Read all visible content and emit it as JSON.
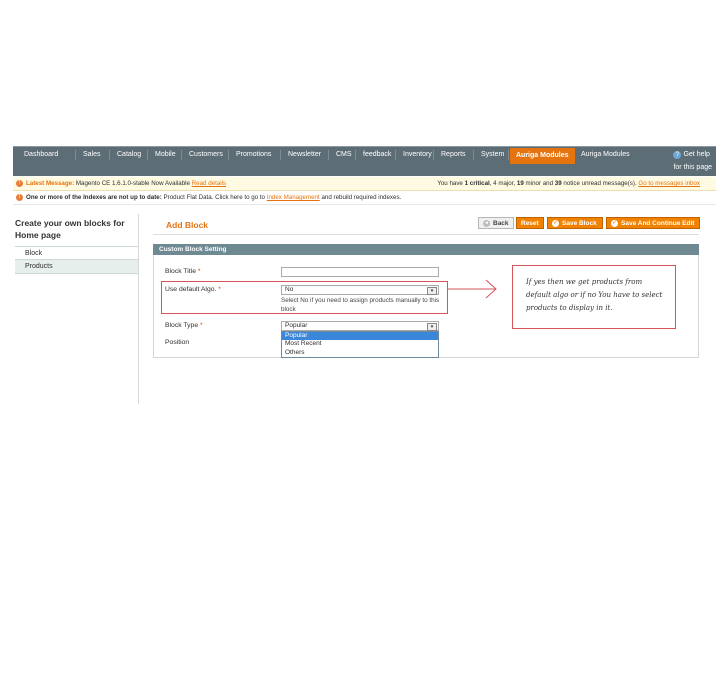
{
  "nav": {
    "items": [
      "Dashboard",
      "Sales",
      "Catalog",
      "Mobile",
      "Customers",
      "Promotions",
      "Newsletter",
      "CMS",
      "feedback",
      "Inventory",
      "Reports",
      "System",
      "Auriga Modules",
      "Auriga Modules"
    ],
    "active_index": 12,
    "help_line1": "Get help",
    "help_line2": "for this page",
    "accent": "#e57310",
    "bar_color": "#5d6d76"
  },
  "messages": {
    "latest_label": "Latest Message:",
    "latest_text": "Magento CE 1.6.1.0-stable Now Available",
    "latest_link": "Read details",
    "notice_prefix": "You have",
    "notice_critical_count": "1",
    "notice_critical": "critical",
    "notice_major": ", 4 major,",
    "notice_minor_count": "19",
    "notice_minor": "minor and",
    "notice_count": "39",
    "notice_rest": "notice unread message(s).",
    "notice_link": "Go to messages inbox",
    "index_label": "One or more of the Indexes are not up to date:",
    "index_text": "Product Flat Data. Click here to go to",
    "index_link": "Index Management",
    "index_rest": "and rebuild required indexes."
  },
  "sidebar": {
    "title": "Create your own blocks for Home page",
    "tabs": [
      "Block",
      "Products"
    ]
  },
  "page": {
    "title": "Add Block",
    "buttons": {
      "back": "Back",
      "reset": "Reset",
      "save": "Save Block",
      "save_continue": "Save And Continue Edit"
    }
  },
  "form": {
    "section_title": "Custom Block Setting",
    "block_title_label": "Block Title",
    "block_title_value": "",
    "default_algo_label": "Use default Algo.",
    "default_algo_value": "No",
    "default_algo_hint": "Select No if you need to assign products manually to this block",
    "block_type_label": "Block Type",
    "block_type_value": "Popular",
    "position_label": "Position",
    "block_type_options": [
      "Popular",
      "Most Recent",
      "Others"
    ],
    "selected_option_index": 0,
    "required_mark": "*"
  },
  "annotation": {
    "note": "If yes then we get products from default algo or if no You have to select products to display in it."
  }
}
